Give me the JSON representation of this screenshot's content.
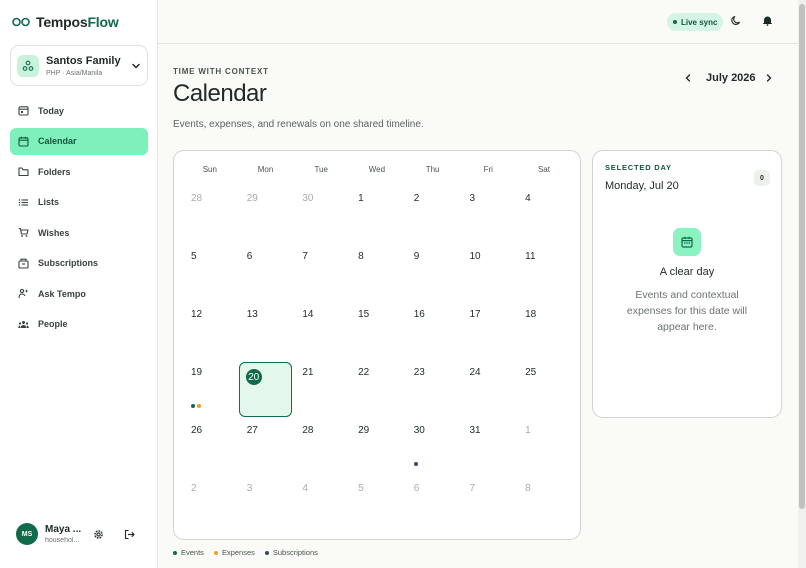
{
  "brand": {
    "name_part1": "Tempos",
    "name_part2": "Flow"
  },
  "family": {
    "name": "Santos Family",
    "subtitle": "PHP · Asia/Manila"
  },
  "sidebar": {
    "items": [
      {
        "label": "Today",
        "icon": "calendar-today-icon",
        "active": false
      },
      {
        "label": "Calendar",
        "icon": "calendar-icon",
        "active": true
      },
      {
        "label": "Folders",
        "icon": "folder-icon",
        "active": false
      },
      {
        "label": "Lists",
        "icon": "list-icon",
        "active": false
      },
      {
        "label": "Wishes",
        "icon": "cart-icon",
        "active": false
      },
      {
        "label": "Subscriptions",
        "icon": "box-icon",
        "active": false
      },
      {
        "label": "Ask Tempo",
        "icon": "sparkle-person-icon",
        "active": false
      },
      {
        "label": "People",
        "icon": "people-icon",
        "active": false
      }
    ]
  },
  "user": {
    "initials": "MS",
    "name": "Maya ...",
    "subtitle": "househol..."
  },
  "topbar": {
    "live_label": "Live sync"
  },
  "header": {
    "eyebrow": "TIME WITH CONTEXT",
    "title": "Calendar",
    "subtitle": "Events, expenses, and renewals on one shared timeline."
  },
  "month_nav": {
    "label": "July 2026"
  },
  "calendar": {
    "weekdays": [
      "Sun",
      "Mon",
      "Tue",
      "Wed",
      "Thu",
      "Fri",
      "Sat"
    ],
    "weeks": [
      [
        {
          "d": "28",
          "m": true
        },
        {
          "d": "29",
          "m": true
        },
        {
          "d": "30",
          "m": true
        },
        {
          "d": "1"
        },
        {
          "d": "2"
        },
        {
          "d": "3"
        },
        {
          "d": "4"
        }
      ],
      [
        {
          "d": "5"
        },
        {
          "d": "6"
        },
        {
          "d": "7"
        },
        {
          "d": "8"
        },
        {
          "d": "9"
        },
        {
          "d": "10"
        },
        {
          "d": "11"
        }
      ],
      [
        {
          "d": "12"
        },
        {
          "d": "13"
        },
        {
          "d": "14"
        },
        {
          "d": "15"
        },
        {
          "d": "16"
        },
        {
          "d": "17"
        },
        {
          "d": "18"
        }
      ],
      [
        {
          "d": "19",
          "dots": [
            "events",
            "expenses"
          ]
        },
        {
          "d": "20",
          "selected": true
        },
        {
          "d": "21"
        },
        {
          "d": "22"
        },
        {
          "d": "23"
        },
        {
          "d": "24"
        },
        {
          "d": "25"
        }
      ],
      [
        {
          "d": "26"
        },
        {
          "d": "27"
        },
        {
          "d": "28"
        },
        {
          "d": "29"
        },
        {
          "d": "30",
          "dots": [
            "subscriptions"
          ]
        },
        {
          "d": "31"
        },
        {
          "d": "1",
          "m": true
        }
      ],
      [
        {
          "d": "2",
          "m": true
        },
        {
          "d": "3",
          "m": true
        },
        {
          "d": "4",
          "m": true
        },
        {
          "d": "5",
          "m": true
        },
        {
          "d": "6",
          "m": true
        },
        {
          "d": "7",
          "m": true
        },
        {
          "d": "8",
          "m": true
        }
      ]
    ]
  },
  "legend": {
    "events": "Events",
    "expenses": "Expenses",
    "subscriptions": "Subscriptions"
  },
  "colors": {
    "events": "#0f6b4a",
    "expenses": "#f0a020",
    "subscriptions": "#2f4a6b",
    "accent": "#7ef0bb"
  },
  "day_panel": {
    "label": "SELECTED DAY",
    "date": "Monday, Jul 20",
    "count": "0",
    "empty_title": "A clear day",
    "empty_body": "Events and contextual expenses for this date will appear here."
  }
}
